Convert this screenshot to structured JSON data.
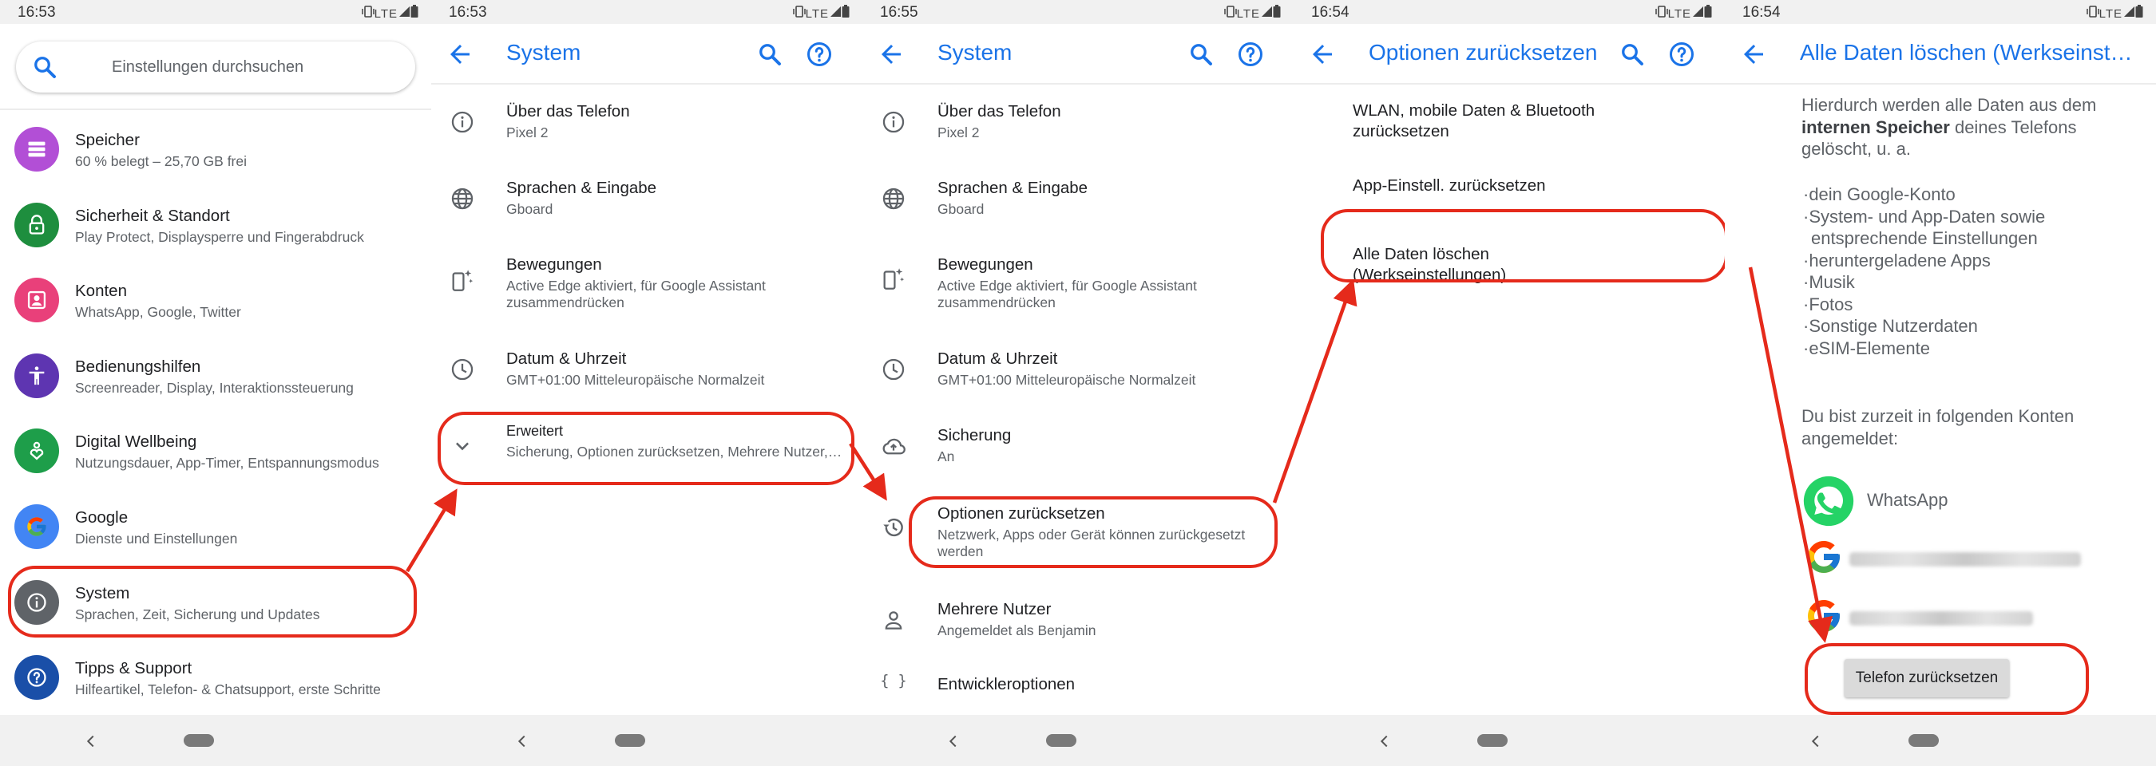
{
  "icons": {
    "back": "arrow-left-icon",
    "search": "magnifier-icon",
    "help": "question-circle-icon",
    "status": "vibrate-lte-signal-battery-icons",
    "nav_back": "chevron-left-icon",
    "nav_home": "pill-home-icon"
  },
  "colors": {
    "accent": "#1a73e8",
    "highlight": "#e52a1b"
  },
  "status": {
    "signal_text": "LTE"
  },
  "panel1": {
    "time": "16:53",
    "search_placeholder": "Einstellungen durchsuchen",
    "items": [
      {
        "title": "Speicher",
        "subtitle": "60 % belegt – 25,70 GB frei",
        "icon": "storage-icon",
        "color": "#b24fd6"
      },
      {
        "title": "Sicherheit & Standort",
        "subtitle": "Play Protect, Displaysperre und Fingerabdruck",
        "icon": "lock-icon",
        "color": "#1e8e3e"
      },
      {
        "title": "Konten",
        "subtitle": "WhatsApp, Google, Twitter",
        "icon": "account-box-icon",
        "color": "#e9407a"
      },
      {
        "title": "Bedienungshilfen",
        "subtitle": "Screenreader, Display, Interaktionssteuerung",
        "icon": "accessibility-icon",
        "color": "#5e35b1"
      },
      {
        "title": "Digital Wellbeing",
        "subtitle": "Nutzungsdauer, App-Timer, Entspannungsmodus",
        "icon": "wellbeing-heart-icon",
        "color": "#1e9e4a"
      },
      {
        "title": "Google",
        "subtitle": "Dienste und Einstellungen",
        "icon": "google-g-icon",
        "color": "#4285f4"
      },
      {
        "title": "System",
        "subtitle": "Sprachen, Zeit, Sicherung und Updates",
        "icon": "info-icon",
        "color": "#5f6368"
      },
      {
        "title": "Tipps & Support",
        "subtitle": "Hilfeartikel, Telefon- & Chatsupport, erste Schritte",
        "icon": "help-icon",
        "color": "#1a4fa8"
      }
    ]
  },
  "panel2": {
    "time": "16:53",
    "title": "System",
    "items": [
      {
        "title": "Über das Telefon",
        "subtitle": "Pixel 2",
        "icon": "info-outline-icon"
      },
      {
        "title": "Sprachen & Eingabe",
        "subtitle": "Gboard",
        "icon": "globe-icon"
      },
      {
        "title": "Bewegungen",
        "subtitle": "Active Edge aktiviert, für Google Assistant zusammendrücken",
        "icon": "phone-sparkle-icon"
      },
      {
        "title": "Datum & Uhrzeit",
        "subtitle": "GMT+01:00 Mitteleuropäische Normalzeit",
        "icon": "clock-icon"
      },
      {
        "title": "Erweitert",
        "subtitle": "Sicherung, Optionen zurücksetzen, Mehrere Nutzer,…",
        "icon": "chevron-down-icon"
      }
    ]
  },
  "panel3": {
    "time": "16:55",
    "title": "System",
    "items": [
      {
        "title": "Über das Telefon",
        "subtitle": "Pixel 2",
        "icon": "info-outline-icon"
      },
      {
        "title": "Sprachen & Eingabe",
        "subtitle": "Gboard",
        "icon": "globe-icon"
      },
      {
        "title": "Bewegungen",
        "subtitle": "Active Edge aktiviert, für Google Assistant zusammendrücken",
        "icon": "phone-sparkle-icon"
      },
      {
        "title": "Datum & Uhrzeit",
        "subtitle": "GMT+01:00 Mitteleuropäische Normalzeit",
        "icon": "clock-icon"
      },
      {
        "title": "Sicherung",
        "subtitle": "An",
        "icon": "cloud-upload-icon"
      },
      {
        "title": "Optionen zurücksetzen",
        "subtitle": "Netzwerk, Apps oder Gerät können zurückgesetzt werden",
        "icon": "history-icon"
      },
      {
        "title": "Mehrere Nutzer",
        "subtitle": "Angemeldet als Benjamin",
        "icon": "person-icon"
      },
      {
        "title": "Entwickleroptionen",
        "subtitle": "",
        "icon": "code-braces-icon"
      }
    ]
  },
  "panel4": {
    "time": "16:54",
    "title": "Optionen zurücksetzen",
    "items": [
      {
        "title": "WLAN, mobile Daten & Bluetooth zurücksetzen"
      },
      {
        "title": "App-Einstell. zurücksetzen"
      },
      {
        "title": "Alle Daten löschen (Werkseinstellungen)"
      }
    ]
  },
  "panel5": {
    "time": "16:54",
    "title": "Alle Daten löschen (Werkseinstellungen)",
    "intro_before": "Hierdurch werden alle Daten aus dem",
    "intro_bold": "internen Speicher",
    "intro_after": "deines Telefons gelöscht, u. a.",
    "bullets": [
      "dein Google-Konto",
      "System- und App-Daten sowie entsprechende Einstellungen",
      "heruntergeladene Apps",
      "Musik",
      "Fotos",
      "Sonstige Nutzerdaten",
      "eSIM-Elemente"
    ],
    "accounts_intro": "Du bist zurzeit in folgenden Konten angemeldet:",
    "accounts": [
      {
        "name": "WhatsApp",
        "icon": "whatsapp-icon"
      },
      {
        "name": "",
        "icon": "google-g-icon"
      },
      {
        "name": "",
        "icon": "google-g-icon"
      }
    ],
    "reset_button": "Telefon zurücksetzen"
  }
}
